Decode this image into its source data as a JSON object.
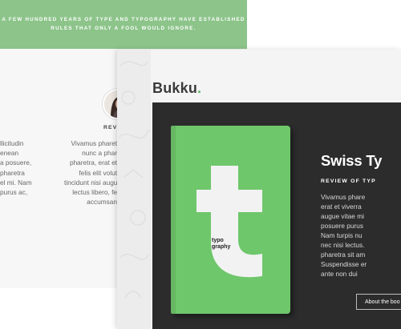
{
  "hero": {
    "line1": "A FEW HUNDRED YEARS OF TYPE AND TYPOGRAPHY HAVE ESTABLISHED",
    "line2": "RULES THAT ONLY A FOOL WOULD IGNORE."
  },
  "back_page": {
    "review_label": "REVIE",
    "left_column": [
      "llicitudin",
      "enean",
      "a posuere,",
      "pharetra",
      "el mi. Nam",
      "purus ac,"
    ],
    "middle_column": [
      "Vivamus pharet",
      "nunc a phar",
      "pharetra, erat et",
      "felis elit volut",
      "tincidunt nisi augu",
      "lectus libero, fe",
      "accumsan"
    ]
  },
  "front_page": {
    "logo_text": "Bukku",
    "logo_dot": ".",
    "book": {
      "cover_letter": "t",
      "cover_word_1": "typo",
      "cover_word_2": "graphy"
    },
    "title": "Swiss Ty",
    "review_label": "REVIEW OF TYP",
    "body_lines": [
      "Vivamus phare",
      "erat et viverra",
      "augue vitae mi",
      "posuere purus",
      "Nam turpis nu",
      "nec nisi lectus.",
      "pharetra sit am",
      "Suspendisse er",
      "ante non dui"
    ],
    "about_button": "About the boo"
  },
  "colors": {
    "hero_green": "#8cc48a",
    "book_green": "#6ec76b",
    "dark_panel": "#2c2c2c",
    "logo_dot": "#65b56c"
  }
}
